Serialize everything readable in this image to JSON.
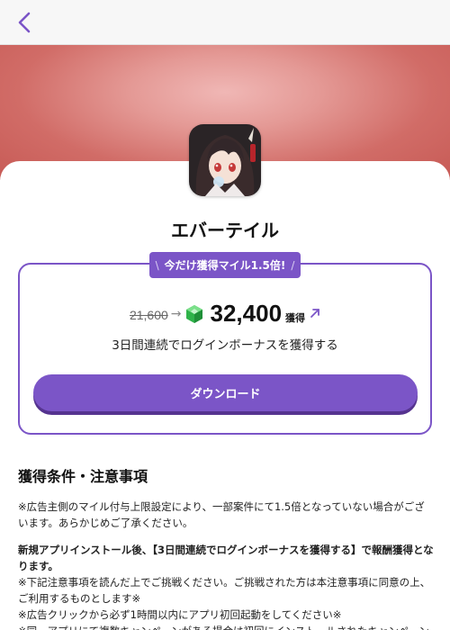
{
  "header": {
    "back_icon": "chevron-left-icon"
  },
  "colors": {
    "accent": "#7b55c7",
    "hero_gradient": [
      "#f0b7b5",
      "#c75a55"
    ]
  },
  "app": {
    "name": "エバーテイル",
    "icon": "app-icon-character-art"
  },
  "promo": {
    "label": "今だけ獲得マイル1.5倍!",
    "left_mark": "\\",
    "right_mark": "/"
  },
  "reward": {
    "original_points": "21,600",
    "points": "32,400",
    "earn_label": "獲得",
    "condition": "3日間連続でログインボーナスを獲得する"
  },
  "download_button": {
    "label": "ダウンロード"
  },
  "notes": {
    "title": "獲得条件・注意事項",
    "paragraph1": "※広告主側のマイル付与上限設定により、一部案件にて1.5倍となっていない場合がございます。あらかじめご了承ください。",
    "paragraph2_bold": "新規アプリインストール後、【3日間連続でログインボーナスを獲得する】で報酬獲得となります。",
    "line1": "※下記注意事項を読んだ上でご挑戦ください。ご挑戦された方は本注意事項に同意の上、ご利用するものとします※",
    "line2": "※広告クリックから必ず1時間以内にアプリ初回起動をしてください※",
    "line3": "※同一アプリにて複数キャンペーンがある場合は初回にインストールされたキャンペーンのみ対象となります※"
  }
}
